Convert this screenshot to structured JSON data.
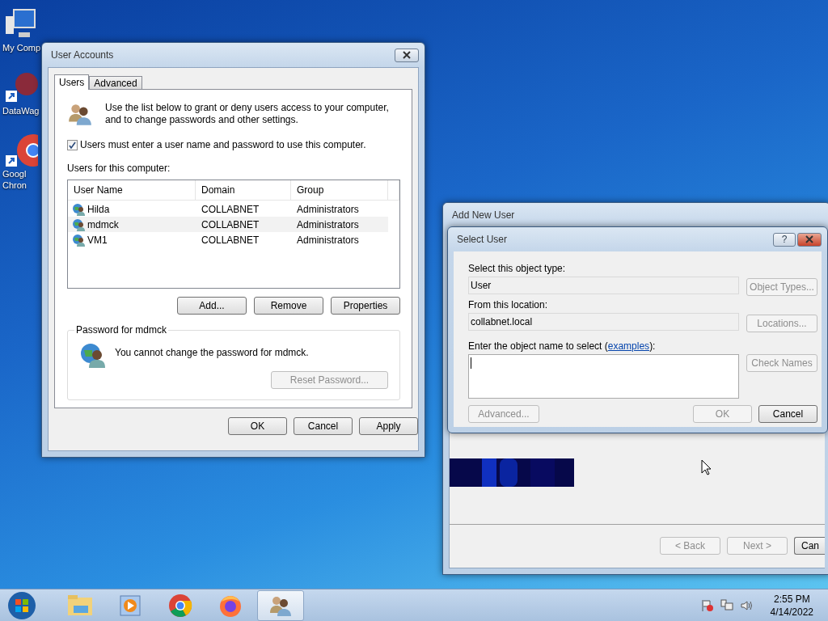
{
  "desktop_icons": [
    {
      "lines": [
        "My Comp"
      ],
      "kind": "computer"
    },
    {
      "lines": [
        "DataWag"
      ],
      "kind": "app"
    },
    {
      "lines": [
        "Googl",
        "Chron"
      ],
      "kind": "chrome"
    }
  ],
  "user_accounts": {
    "title": "User Accounts",
    "tabs": [
      {
        "label": "Users",
        "selected": true
      },
      {
        "label": "Advanced",
        "selected": false
      }
    ],
    "intro": "Use the list below to grant or deny users access to your computer, and to change passwords and other settings.",
    "require_login": {
      "label": "Users must enter a user name and password to use this computer.",
      "checked": true
    },
    "users_label": "Users for this computer:",
    "table": {
      "columns": [
        "User Name",
        "Domain",
        "Group"
      ],
      "rows": [
        {
          "cells": [
            "Hilda",
            "COLLABNET",
            "Administrators"
          ],
          "selected": false
        },
        {
          "cells": [
            "mdmck",
            "COLLABNET",
            "Administrators"
          ],
          "selected": true
        },
        {
          "cells": [
            "VM1",
            "COLLABNET",
            "Administrators"
          ],
          "selected": false
        }
      ]
    },
    "list_buttons": [
      {
        "label": "Add...",
        "disabled": false
      },
      {
        "label": "Remove",
        "disabled": false
      },
      {
        "label": "Properties",
        "disabled": false
      }
    ],
    "password_group": {
      "title": "Password for mdmck",
      "message": "You cannot change the password for mdmck.",
      "reset_button": {
        "label": "Reset Password...",
        "disabled": true
      }
    },
    "footer_buttons": [
      {
        "label": "OK",
        "disabled": false
      },
      {
        "label": "Cancel",
        "disabled": false
      },
      {
        "label": "Apply",
        "disabled": false
      }
    ]
  },
  "add_new_user": {
    "title": "Add New User",
    "buttons": [
      {
        "label": "< Back",
        "disabled": true
      },
      {
        "label": "Next >",
        "disabled": true
      },
      {
        "label": "Can",
        "disabled": false
      }
    ]
  },
  "select_user": {
    "title": "Select User",
    "help": "?",
    "object_type_label": "Select this object type:",
    "object_type": "User",
    "object_types_button": "Object Types...",
    "location_label": "From this location:",
    "location": "collabnet.local",
    "locations_button": "Locations...",
    "name_label": "Enter the object name to select (",
    "name_link": "examples",
    "name_label_end": "):",
    "check_names_button": {
      "label": "Check Names",
      "disabled": true
    },
    "advanced_button": {
      "label": "Advanced...",
      "disabled": true
    },
    "ok_button": {
      "label": "OK",
      "disabled": true
    },
    "cancel_button": {
      "label": "Cancel",
      "disabled": false
    }
  },
  "taskbar": {
    "items": [
      {
        "kind": "explorer",
        "selected": false
      },
      {
        "kind": "media",
        "selected": false
      },
      {
        "kind": "chrome",
        "selected": false
      },
      {
        "kind": "firefox",
        "selected": false
      },
      {
        "kind": "users",
        "selected": true
      }
    ],
    "time": "2:55 PM",
    "date": "4/14/2022"
  }
}
